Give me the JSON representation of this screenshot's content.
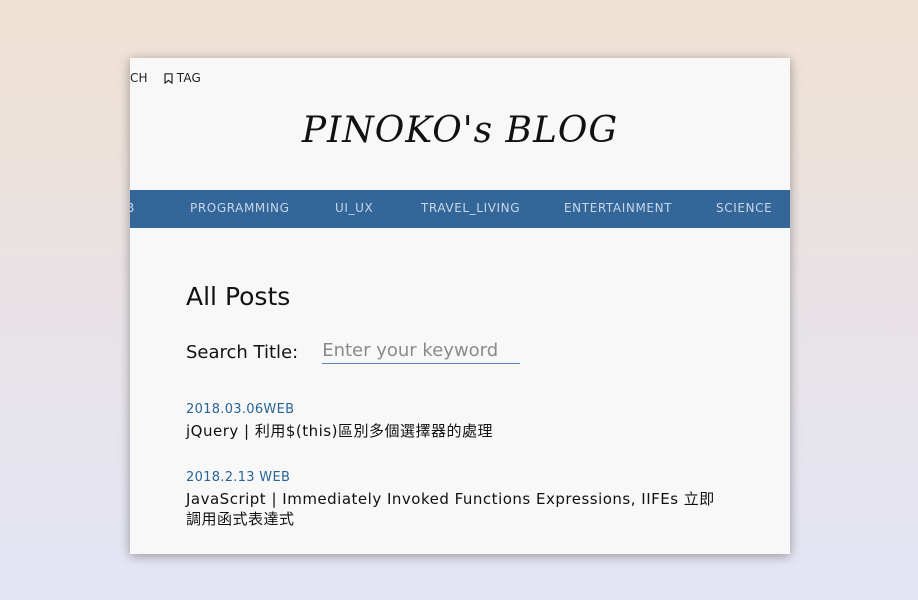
{
  "header": {
    "search_link": "RCH",
    "tag_link": "TAG",
    "tag_icon": "bookmark-icon"
  },
  "site_title": "PINOKO's BLOG",
  "nav": {
    "items": [
      {
        "label": "B"
      },
      {
        "label": "PROGRAMMING"
      },
      {
        "label": "UI_UX"
      },
      {
        "label": "TRAVEL_LIVING"
      },
      {
        "label": "ENTERTAINMENT"
      },
      {
        "label": "SCIENCE"
      }
    ],
    "background": "#336699"
  },
  "main": {
    "heading": "All Posts",
    "search_label": "Search Title:",
    "search_placeholder": "Enter your keyword",
    "search_value": ""
  },
  "posts": [
    {
      "date": "2018.03.06WEB",
      "title": "jQuery | 利用$(this)區別多個選擇器的處理"
    },
    {
      "date": "2018.2.13  WEB",
      "title": "JavaScript | Immediately Invoked Functions Expressions, IIFEs 立即調用函式表達式"
    }
  ]
}
